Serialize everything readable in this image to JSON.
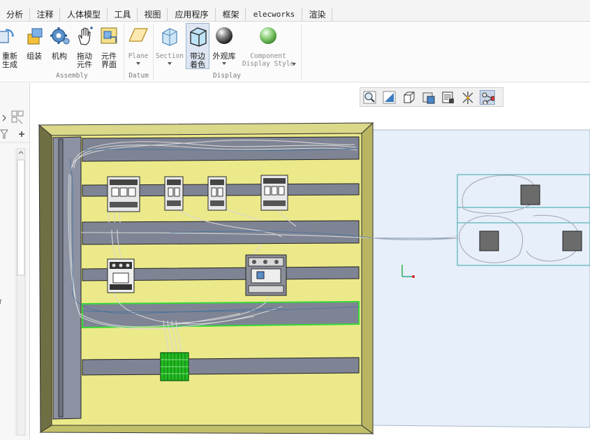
{
  "tabs": [
    {
      "label": "分析"
    },
    {
      "label": "注释"
    },
    {
      "label": "人体模型"
    },
    {
      "label": "工具"
    },
    {
      "label": "视图"
    },
    {
      "label": "应用程序"
    },
    {
      "label": "框架"
    },
    {
      "label": "elecworks"
    },
    {
      "label": "渲染"
    }
  ],
  "ribbon": {
    "regenerate_line1": "重新",
    "regenerate_line2": "生成",
    "assemble": "组装",
    "mechanism": "机构",
    "drag_line1": "拖动",
    "drag_line2": "元件",
    "component_line1": "元件",
    "component_line2": "界面",
    "plane": "Plane",
    "section": "Section",
    "shaded_line1": "带边",
    "shaded_line2": "着色",
    "appearance": "外观库",
    "component_display_line1": "Component",
    "component_display_line2": "Display Style",
    "group_assembly": "Assembly",
    "group_datum": "Datum",
    "group_display": "Display"
  },
  "icons": {
    "regenerate": "regenerate-icon",
    "assemble": "assemble-icon",
    "mechanism": "gear-icon",
    "drag": "hand-icon",
    "component_interface": "component-interface-icon",
    "plane": "plane-icon",
    "section": "section-icon",
    "shaded": "cube-shaded-icon",
    "appearance": "sphere-icon",
    "component_display": "green-sphere-icon"
  },
  "leftpanel": {
    "edge_text": "T"
  },
  "view_toolbar": [
    {
      "name": "zoom-icon"
    },
    {
      "name": "refit-icon"
    },
    {
      "name": "saved-orientation-icon"
    },
    {
      "name": "display-style-icon"
    },
    {
      "name": "view-manager-icon"
    },
    {
      "name": "datum-display-icon"
    },
    {
      "name": "cable-display-icon",
      "active": true
    }
  ],
  "colors": {
    "panel_yellow": "#ece98a",
    "panel_edge": "#707048",
    "rail_gray": "#7f8494",
    "side_panel": "#e4eefa",
    "selected_green": "#36d936",
    "terminal_green": "#22bb22"
  }
}
